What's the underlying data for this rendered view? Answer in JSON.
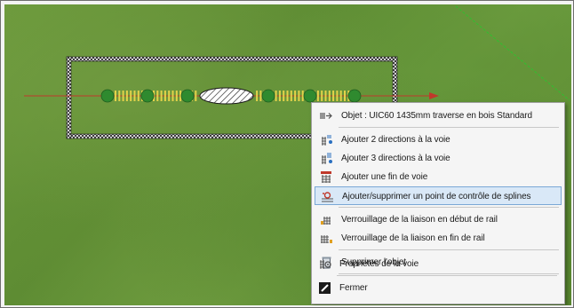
{
  "context_menu": {
    "items": [
      {
        "label": "Objet : UIC60 1435mm traverse en bois Standard",
        "icon": "track-object-icon"
      },
      {
        "label": "Ajouter 2 directions à la voie",
        "icon": "track-add-2-directions-icon"
      },
      {
        "label": "Ajouter 3 directions à la voie",
        "icon": "track-add-3-directions-icon"
      },
      {
        "label": "Ajouter une fin de voie",
        "icon": "track-end-icon"
      },
      {
        "label": "Ajouter/supprimer un point de contrôle de splines",
        "icon": "spline-control-point-icon"
      },
      {
        "label": "Verrouillage de la liaison en début de rail",
        "icon": "lock-rail-start-icon"
      },
      {
        "label": "Verrouillage de la liaison en fin de rail",
        "icon": "lock-rail-end-icon"
      },
      {
        "label": "Supprimer l'objet",
        "icon": "trash-icon"
      },
      {
        "label": "Propriétés de la voie",
        "icon": "track-properties-icon"
      },
      {
        "label": "Fermer",
        "icon": "close-icon"
      }
    ],
    "highlighted_index": 4
  },
  "colors": {
    "highlight_bg": "#d9e8f7",
    "highlight_border": "#7aa8d6",
    "control_point": "#2f8a2f",
    "track_axis": "#c0392b",
    "tie": "#e3d24a",
    "selection_box": "#ffffff"
  }
}
